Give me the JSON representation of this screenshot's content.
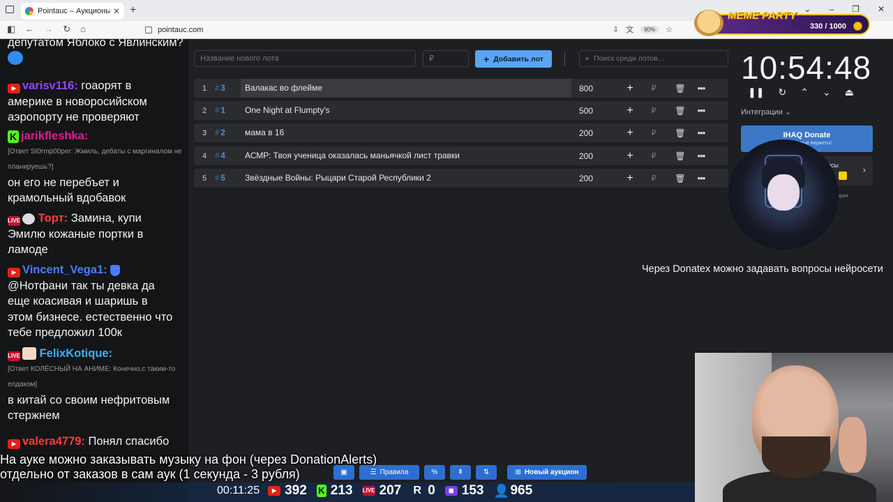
{
  "browser": {
    "tab_title": "Pointauc – Аукционы, лотереи",
    "url": "pointauc.com",
    "zoom": "90%"
  },
  "meme_party": {
    "title": "MEME PARTY",
    "count": "330 / 1000"
  },
  "chat": {
    "messages": [
      {
        "text": "депутатом Яблоко с Явлинским?"
      },
      {
        "nick": "varisv116:",
        "nick_color": "#9147ff",
        "text": "гоаорят в америке в новоросийском аэропорту не проверяют"
      },
      {
        "nick": "jarikfleshka:",
        "nick_color": "#e02090",
        "reply": "[Ответ St0rmp00per: Жмиль, дебаты с маргиналом не планируешь?]",
        "text": "он его не перебъет и крамольный вдобавок"
      },
      {
        "nick": "Торт:",
        "nick_color": "#ff4040",
        "text": "Замина, купи Эмилю кожаные портки в ламоде"
      },
      {
        "nick": "Vincent_Vega1:",
        "nick_color": "#4a7cff",
        "text": "@Нотфани так ты девка да еще коасивая и шаришь в этом бизнесе. естественно что тебе предложил 100к"
      },
      {
        "nick": "FelixKotique:",
        "nick_color": "#3ab0ff",
        "reply": "[Ответ КОЛЁСНЫЙ НА АНИМЕ: Конечно,с таким-то елдаком]",
        "text": "в китай со своим нефритовым стержнем"
      },
      {
        "nick": "valera4779:",
        "nick_color": "#ff3b3b",
        "text": "Понял спасибо"
      }
    ]
  },
  "auction": {
    "new_lot_placeholder": "Название нового лота",
    "amount_placeholder": "₽",
    "add_lot_label": "Добавить лот",
    "search_placeholder": "Поиск среди лотов...",
    "lots": [
      {
        "index": "1",
        "fast_id": "3",
        "name": "Валакас во флейме",
        "amount": "800"
      },
      {
        "index": "2",
        "fast_id": "1",
        "name": "One Night at Flumpty's",
        "amount": "500"
      },
      {
        "index": "3",
        "fast_id": "2",
        "name": "мама в 16",
        "amount": "200"
      },
      {
        "index": "4",
        "fast_id": "4",
        "name": "АСМР: Твоя ученица оказалась маньячкой лист травки",
        "amount": "200"
      },
      {
        "index": "5",
        "fast_id": "5",
        "name": "Звёздные Войны: Рыцари Старой Республики 2",
        "amount": "200"
      }
    ],
    "currency": "₽"
  },
  "timer": {
    "time": "10:54:48"
  },
  "integrations": {
    "label": "Интеграции",
    "donate_title": "IHAQ Donate",
    "donate_sub": "Актуальные виджеты!",
    "card2_label": "исы",
    "card2_sub": "ория"
  },
  "ticker": "Через Donatex можно задавать вопросы нейросети",
  "bottom_note": {
    "line1": "На ауке можно заказывать музыку на фон (через DonationAlerts)",
    "line2": "отдельно от заказов в сам аук (1 секунда - 3 рубля)"
  },
  "toolbar": {
    "rules_label": "Правила",
    "new_auction_label": "Новый аукцион"
  },
  "stats": {
    "elapsed": "00:11:25",
    "youtube": "392",
    "kick": "213",
    "vk_live": "207",
    "rutube": "0",
    "twitch": "153",
    "total": "965"
  },
  "colors": {
    "accent": "#5aa4f5",
    "row_bg": "#2b2c30",
    "fast_id": "#4a90e2"
  }
}
